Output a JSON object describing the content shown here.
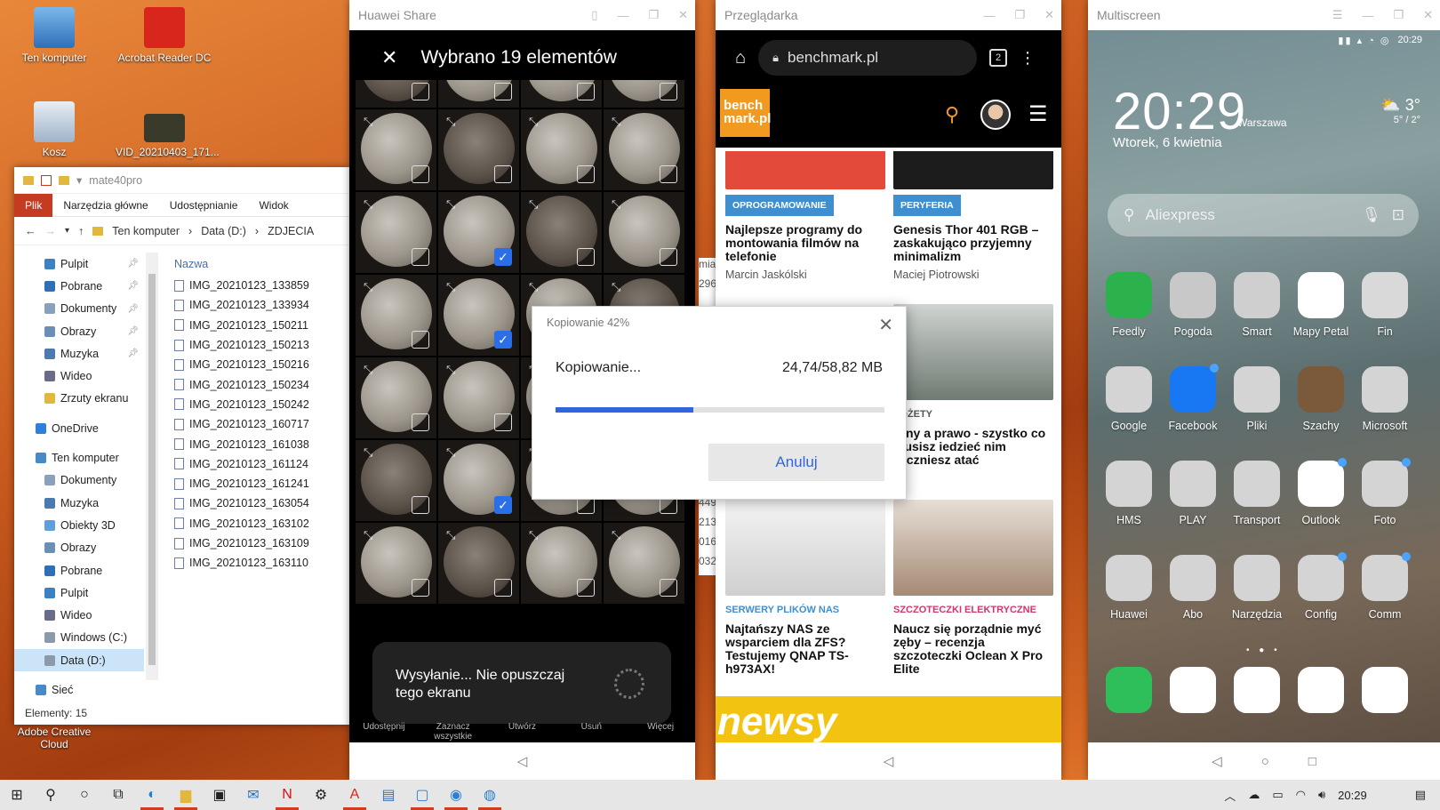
{
  "desktop": {
    "icons": [
      {
        "label": "Ten komputer",
        "icon": "computer-icon"
      },
      {
        "label": "Acrobat Reader DC",
        "icon": "acrobat-icon"
      },
      {
        "label": "Kosz",
        "icon": "recycle-bin-icon"
      },
      {
        "label": "VID_20210403_171...",
        "icon": "video-file-icon"
      },
      {
        "label": "Adobe Creative Cloud",
        "icon": "creative-cloud-icon"
      }
    ]
  },
  "explorer": {
    "title": "mate40pro",
    "ribbon": [
      "Plik",
      "Narzędzia główne",
      "Udostępnianie",
      "Widok"
    ],
    "breadcrumb": [
      "Ten komputer",
      "Data (D:)",
      "ZDJECIA"
    ],
    "tree": [
      {
        "label": "Pulpit",
        "pinned": true,
        "color": "#3b82c4"
      },
      {
        "label": "Pobrane",
        "pinned": true,
        "color": "#2f6fb8"
      },
      {
        "label": "Dokumenty",
        "pinned": true,
        "color": "#8aa1bd"
      },
      {
        "label": "Obrazy",
        "pinned": true,
        "color": "#6a8fb6"
      },
      {
        "label": "Muzyka",
        "pinned": true,
        "color": "#4a7ab0"
      },
      {
        "label": "Wideo",
        "pinned": false,
        "color": "#6a6a8a"
      },
      {
        "label": "Zrzuty ekranu",
        "pinned": false,
        "color": "#e2b740"
      },
      {
        "label": "OneDrive",
        "pinned": false,
        "color": "#2f80d8"
      },
      {
        "label": "Ten komputer",
        "pinned": false,
        "color": "#4a89c8"
      },
      {
        "label": "Dokumenty",
        "pinned": false,
        "color": "#8aa1bd"
      },
      {
        "label": "Muzyka",
        "pinned": false,
        "color": "#4a7ab0"
      },
      {
        "label": "Obiekty 3D",
        "pinned": false,
        "color": "#5fa0d8"
      },
      {
        "label": "Obrazy",
        "pinned": false,
        "color": "#6a8fb6"
      },
      {
        "label": "Pobrane",
        "pinned": false,
        "color": "#2f6fb8"
      },
      {
        "label": "Pulpit",
        "pinned": false,
        "color": "#3b82c4"
      },
      {
        "label": "Wideo",
        "pinned": false,
        "color": "#6a6a8a"
      },
      {
        "label": "Windows (C:)",
        "pinned": false,
        "color": "#8a9aaa"
      },
      {
        "label": "Data (D:)",
        "pinned": false,
        "color": "#8a9aaa"
      },
      {
        "label": "Sieć",
        "pinned": false,
        "color": "#4a89c8"
      }
    ],
    "column_header": "Nazwa",
    "files": [
      "IMG_20210123_133859",
      "IMG_20210123_133934",
      "IMG_20210123_150211",
      "IMG_20210123_150213",
      "IMG_20210123_150216",
      "IMG_20210123_150234",
      "IMG_20210123_150242",
      "IMG_20210123_160717",
      "IMG_20210123_161038",
      "IMG_20210123_161124",
      "IMG_20210123_161241",
      "IMG_20210123_163054",
      "IMG_20210123_163102",
      "IMG_20210123_163109",
      "IMG_20210123_163110"
    ],
    "partial_column": [
      "miar",
      "296",
      "",
      "",
      "",
      "",
      "",
      "",
      "",
      "",
      "",
      "",
      "449",
      "213",
      "016",
      "032"
    ],
    "status": "Elementy: 15"
  },
  "share": {
    "window_title": "Huawei Share",
    "header": "Wybrano 19 elementów",
    "selected_tiles": [
      9,
      13,
      21
    ],
    "toast": "Wysyłanie... Nie opuszczaj tego ekranu",
    "actions": [
      "Udostępnij",
      "Zaznacz wszystkie",
      "Utwórz",
      "Usuń",
      "Więcej"
    ]
  },
  "copy_dialog": {
    "title": "Kopiowanie 42%",
    "label": "Kopiowanie...",
    "size": "24,74/58,82 MB",
    "progress": 0.42,
    "cancel": "Anuluj"
  },
  "browser": {
    "window_title": "Przeglądarka",
    "url": "benchmark.pl",
    "tab_count": "2",
    "logo": "bench mark.pl",
    "cards": [
      {
        "tag": "OPROGRAMOWANIE",
        "title": "Najlepsze programy do montowania filmów na telefonie",
        "author": "Marcin Jaskólski"
      },
      {
        "tag": "PERYFERIA",
        "title": "Genesis Thor 401 RGB – zaskakująco przyjemny minimalizm",
        "author": "Maciej Piotrowski"
      },
      {
        "tag": "ADŻETY",
        "title": "rony a prawo - szystko co musisz iedzieć nim zaczniesz atać",
        "author": ""
      },
      {
        "tag": "SERWERY PLIKÓW NAS",
        "title": "Najtańszy NAS ze wsparciem dla ZFS? Testujemy QNAP TS-h973AX!",
        "author": ""
      },
      {
        "tag": "SZCZOTECZKI ELEKTRYCZNE",
        "title": "Naucz się porządnie myć zęby – recenzja szczoteczki Oclean X Pro Elite",
        "author": ""
      }
    ],
    "banner": "newsy"
  },
  "phone": {
    "window_title": "Multiscreen",
    "status_time": "20:29",
    "clock": "20:29",
    "city": "Warszawa",
    "date": "Wtorek, 6 kwietnia",
    "temp": "3°",
    "temp_range": "5° / 2°",
    "search_placeholder": "Aliexpress",
    "apps": [
      {
        "label": "Feedly",
        "color": "#2bb24c",
        "badge": false
      },
      {
        "label": "Pogoda",
        "color": "#c8c8c8",
        "badge": false
      },
      {
        "label": "Smart",
        "color": "#cfcfcf",
        "badge": false
      },
      {
        "label": "Mapy Petal",
        "color": "#ffffff",
        "badge": false
      },
      {
        "label": "Fin",
        "color": "#d9d9d9",
        "badge": false
      },
      {
        "label": "Google",
        "color": "#d4d4d4",
        "badge": false
      },
      {
        "label": "Facebook",
        "color": "#1877f2",
        "badge": true
      },
      {
        "label": "Pliki",
        "color": "#d4d4d4",
        "badge": false
      },
      {
        "label": "Szachy",
        "color": "#7a5a3a",
        "badge": false
      },
      {
        "label": "Microsoft",
        "color": "#d4d4d4",
        "badge": false
      },
      {
        "label": "HMS",
        "color": "#d4d4d4",
        "badge": false
      },
      {
        "label": "PLAY",
        "color": "#d4d4d4",
        "badge": false
      },
      {
        "label": "Transport",
        "color": "#d4d4d4",
        "badge": false
      },
      {
        "label": "Outlook",
        "color": "#ffffff",
        "badge": true
      },
      {
        "label": "Foto",
        "color": "#d4d4d4",
        "badge": true
      },
      {
        "label": "Huawei",
        "color": "#d4d4d4",
        "badge": false
      },
      {
        "label": "Abo",
        "color": "#d4d4d4",
        "badge": false
      },
      {
        "label": "Narzędzia",
        "color": "#d4d4d4",
        "badge": false
      },
      {
        "label": "Config",
        "color": "#d4d4d4",
        "badge": true
      },
      {
        "label": "Comm",
        "color": "#d4d4d4",
        "badge": true
      }
    ],
    "dock": [
      {
        "icon": "phone-icon",
        "color": "#2fbf5a"
      },
      {
        "icon": "messenger-icon",
        "color": "#ffffff"
      },
      {
        "icon": "gallery-icon",
        "color": "#ffffff"
      },
      {
        "icon": "browser-icon",
        "color": "#ffffff"
      },
      {
        "icon": "camera-icon",
        "color": "#ffffff"
      }
    ]
  },
  "taskbar": {
    "time": "20:29"
  }
}
